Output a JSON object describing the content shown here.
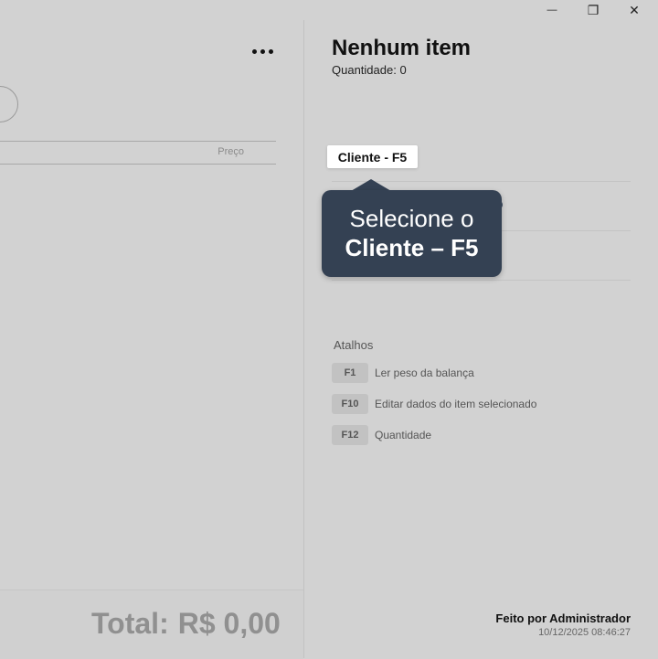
{
  "window_controls": {
    "minimize": "—",
    "restore": "❐",
    "close": "✕"
  },
  "left": {
    "table_header": {
      "price_col": "Preço"
    },
    "total_label": "Total:",
    "total_value": "R$ 0,00"
  },
  "right": {
    "title": "Nenhum item",
    "quantity": "Quantidade: 0",
    "client_button": "Cliente - F5",
    "tooltip": {
      "line1": "Selecione o",
      "line2": "Cliente – F5"
    },
    "shortcuts_title": "Atalhos",
    "shortcuts": [
      {
        "key": "F1",
        "label": "Ler peso da balança"
      },
      {
        "key": "F10",
        "label": "Editar dados do item selecionado"
      },
      {
        "key": "F12",
        "label": "Quantidade"
      }
    ],
    "made_by": "Feito por Administrador",
    "datetime": "10/12/2025 08:46:27"
  },
  "colors": {
    "overlay_bg": "#d2d2d2",
    "tooltip_bg": "#344153",
    "client_button_bg": "#ffffff"
  }
}
